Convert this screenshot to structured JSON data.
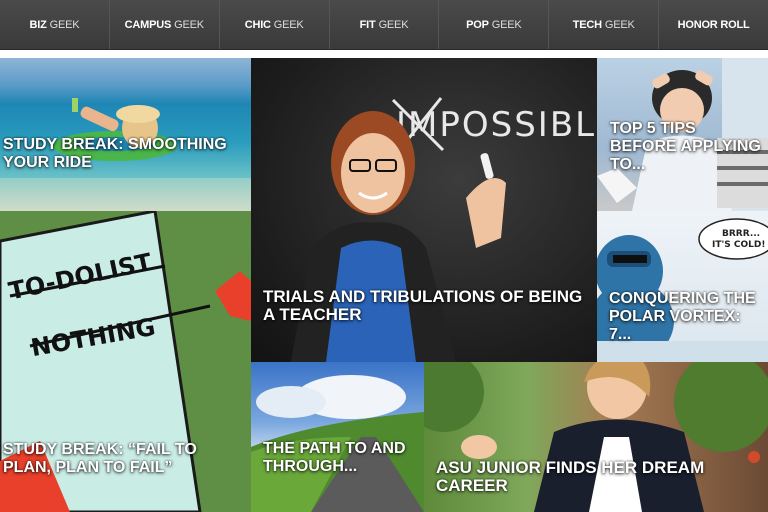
{
  "nav": {
    "items": [
      {
        "bold": "BIZ",
        "light": "GEEK"
      },
      {
        "bold": "CAMPUS",
        "light": "GEEK"
      },
      {
        "bold": "CHIC",
        "light": "GEEK"
      },
      {
        "bold": "FIT",
        "light": "GEEK"
      },
      {
        "bold": "POP",
        "light": "GEEK"
      },
      {
        "bold": "TECH",
        "light": "GEEK"
      },
      {
        "bold": "HONOR ROLL",
        "light": ""
      }
    ]
  },
  "tiles": [
    {
      "title": "STUDY BREAK: SMOOTHING YOUR RIDE"
    },
    {
      "title": "TRIALS AND TRIBULATIONS OF BEING A TEACHER"
    },
    {
      "title": "TOP 5 TIPS BEFORE APPLYING TO..."
    },
    {
      "title": "STUDY BREAK: “FAIL TO PLAN, PLAN TO FAIL”"
    },
    {
      "title": "CONQUERING THE POLAR VORTEX: 7..."
    },
    {
      "title": "THE PATH TO AND THROUGH..."
    },
    {
      "title": "ASU JUNIOR FINDS HER DREAM CAREER"
    }
  ],
  "images": {
    "chalkboard_text": "IMPOSSIBLE",
    "note_title": "TO-DOLIST",
    "note_item": "NOTHING",
    "bubble_text": "BRRR... IT'S COLD!"
  }
}
